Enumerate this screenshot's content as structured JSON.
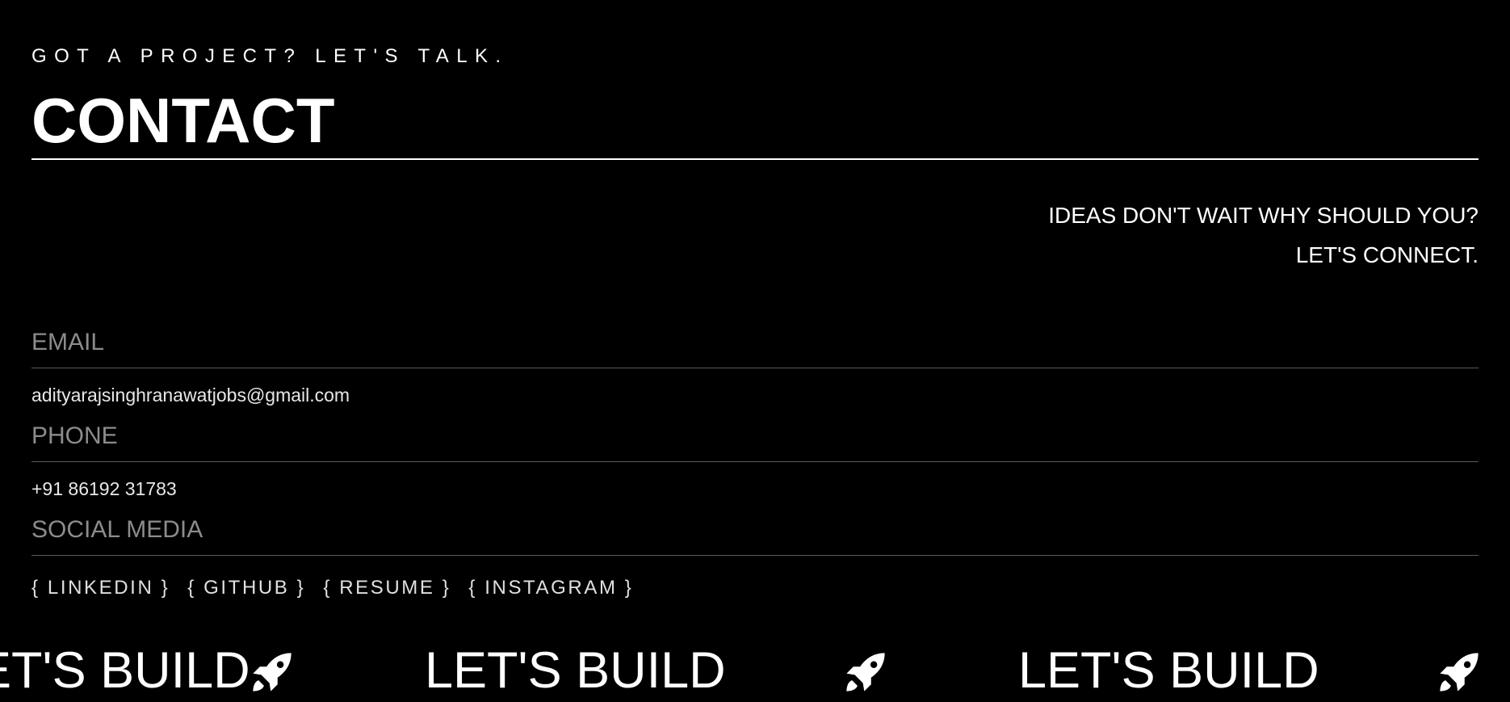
{
  "header": {
    "eyebrow": "GOT A PROJECT? LET'S TALK.",
    "title": "CONTACT"
  },
  "tagline": {
    "line1": "IDEAS DON'T WAIT WHY SHOULD YOU?",
    "line2": "LET'S CONNECT."
  },
  "contact": {
    "email_label": "EMAIL",
    "email_value": "adityarajsinghranawatjobs@gmail.com",
    "phone_label": "PHONE",
    "phone_value": "+91 86192 31783",
    "social_label": "SOCIAL MEDIA",
    "social_links": [
      "{ LINKEDIN }",
      "{ GITHUB }",
      "{ RESUME }",
      "{ INSTAGRAM }"
    ]
  },
  "marquee": {
    "items": [
      "LET'S BUILD",
      "LET'S BUILD",
      "LET'S BUILD"
    ],
    "icon": "rocket-icon"
  },
  "colors": {
    "background": "#000000",
    "text": "#ffffff",
    "muted_label": "#8c8c8c",
    "divider": "#5a5a5a"
  }
}
